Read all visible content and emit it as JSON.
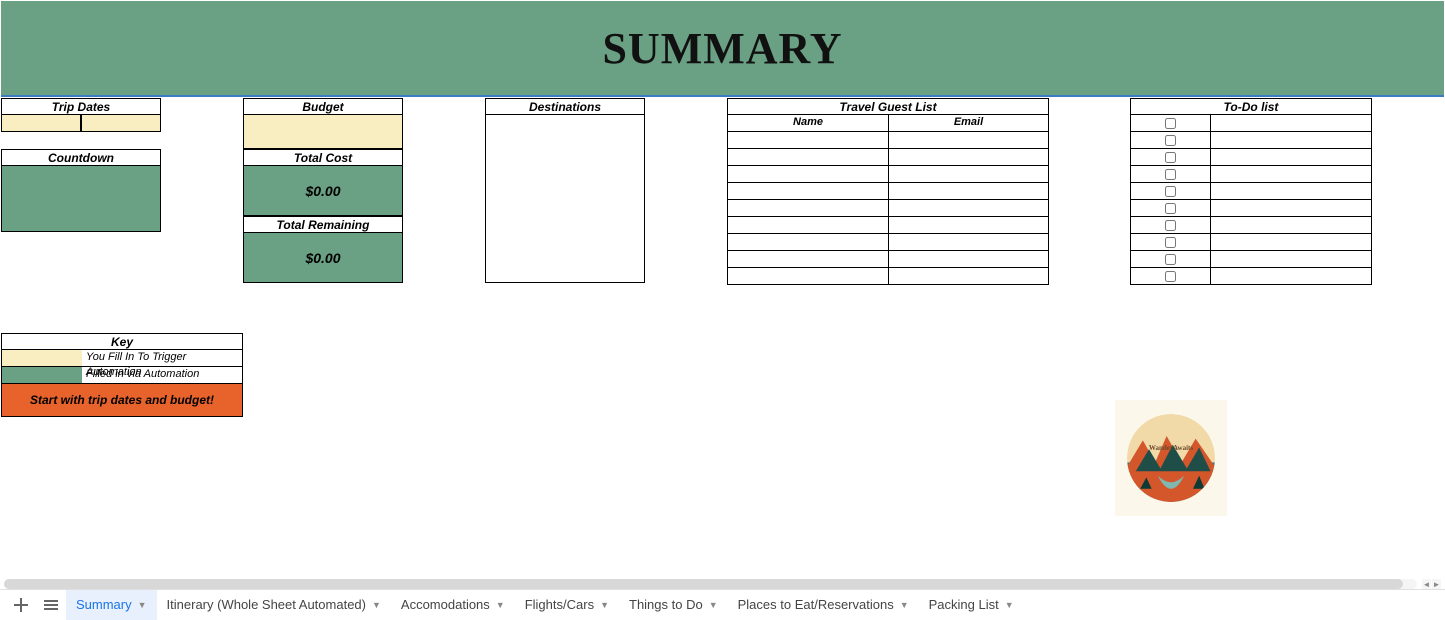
{
  "banner": {
    "title": "SUMMARY"
  },
  "tripDates": {
    "header": "Trip Dates"
  },
  "countdown": {
    "header": "Countdown"
  },
  "budget": {
    "header": "Budget"
  },
  "totalCost": {
    "header": "Total Cost",
    "value": "$0.00"
  },
  "totalRemaining": {
    "header": "Total Remaining",
    "value": "$0.00"
  },
  "destinations": {
    "header": "Destinations"
  },
  "guestList": {
    "header": "Travel Guest List",
    "col1": "Name",
    "col2": "Email",
    "rowCount": 9
  },
  "todo": {
    "header": "To-Do list",
    "rowCount": 10
  },
  "key": {
    "header": "Key",
    "row1": "You Fill In To Trigger Automation",
    "row2": "Filled in via Automation",
    "start": "Start with trip dates and budget!"
  },
  "logo": {
    "text": "WanderAwaits"
  },
  "tabs": [
    {
      "label": "Summary",
      "active": true
    },
    {
      "label": "Itinerary (Whole Sheet Automated)",
      "active": false
    },
    {
      "label": "Accomodations",
      "active": false
    },
    {
      "label": "Flights/Cars",
      "active": false
    },
    {
      "label": "Things to Do",
      "active": false
    },
    {
      "label": "Places to Eat/Reservations",
      "active": false
    },
    {
      "label": "Packing List",
      "active": false
    }
  ],
  "colors": {
    "bannerBg": "#6aa084",
    "inputBg": "#f9eec2",
    "autoBg": "#6aa084",
    "warnBg": "#e8622c"
  }
}
